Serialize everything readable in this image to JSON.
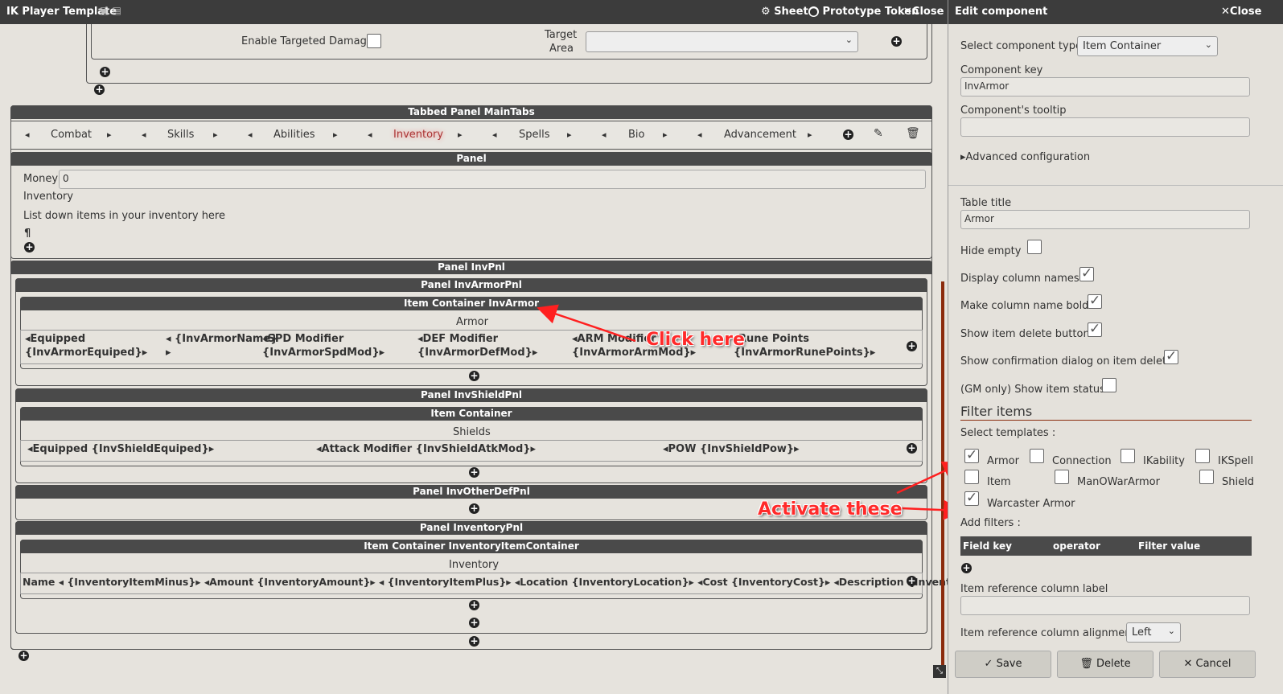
{
  "window": {
    "title": "IK Player Template",
    "sheet_label": "Sheet",
    "proto_label": "Prototype Token",
    "close_label": "Close"
  },
  "top_section": {
    "targeted_damage_label": "Enable Targeted Damage",
    "target_area_label_1": "Target",
    "target_area_label_2": "Area"
  },
  "tabbed_panel": {
    "header": "Tabbed Panel MainTabs",
    "tabs": [
      "Combat",
      "Skills",
      "Abilities",
      "Inventory",
      "Spells",
      "Bio",
      "Advancement"
    ],
    "active_tab": "Inventory"
  },
  "panel": {
    "header": "Panel",
    "money_label": "Money",
    "money_value": "0",
    "inventory_label": "Inventory",
    "description": "List down items in your inventory here",
    "pilcrow": "¶"
  },
  "panel_invpnl": {
    "header": "Panel InvPnl",
    "armor_panel_header": "Panel InvArmorPnl",
    "armor_container_header": "Item Container InvArmor",
    "armor_title": "Armor",
    "armor_cols": [
      {
        "line1": "◂Equipped",
        "line2": "{InvArmorEquiped}▸"
      },
      {
        "line1": "◂ {InvArmorName}",
        "line2": "▸"
      },
      {
        "line1": "◂SPD Modifier",
        "line2": "{InvArmorSpdMod}▸"
      },
      {
        "line1": "◂DEF Modifier",
        "line2": "{InvArmorDefMod}▸"
      },
      {
        "line1": "◂ARM Modifier",
        "line2": "{InvArmorArmMod}▸"
      },
      {
        "line1": "Rune Points",
        "line2": "{InvArmorRunePoints}▸"
      }
    ],
    "shield_panel_header": "Panel InvShieldPnl",
    "shield_container_header": "Item Container",
    "shield_title": "Shields",
    "shield_cols": [
      "◂Equipped {InvShieldEquiped}▸",
      "◂Attack Modifier {InvShieldAtkMod}▸",
      "◂POW {InvShieldPow}▸"
    ],
    "otherdef_header": "Panel InvOtherDefPnl",
    "inventory_panel_header": "Panel InventoryPnl",
    "inventory_container_header": "Item Container InventoryItemContainer",
    "inventory_title": "Inventory",
    "inventory_cols": "Name ◂ {InventoryItemMinus}▸ ◂Amount {InventoryAmount}▸ ◂ {InventoryItemPlus}▸ ◂Location {InventoryLocation}▸ ◂Cost {InventoryCost}▸ ◂Description {InventoryDescription}▸"
  },
  "annotations": {
    "click_here": "Click here",
    "activate_these": "Activate these"
  },
  "edit": {
    "header": "Edit component",
    "close_label": "Close",
    "type_label": "Select component type",
    "type_value": "Item Container",
    "key_label": "Component key",
    "key_value": "InvArmor",
    "tooltip_label": "Component's tooltip",
    "tooltip_value": "",
    "advanced": "▸Advanced configuration",
    "table_title_label": "Table title",
    "table_title_value": "Armor",
    "options": [
      {
        "label": "Hide empty",
        "checked": false
      },
      {
        "label": "Display column names",
        "checked": true
      },
      {
        "label": "Make column name bold",
        "checked": true
      },
      {
        "label": "Show item delete button",
        "checked": true
      },
      {
        "label": "Show confirmation dialog on item delete",
        "checked": true
      },
      {
        "label": "(GM only) Show item status",
        "checked": false
      }
    ],
    "filter_heading": "Filter items",
    "select_templates": "Select templates :",
    "templates": [
      {
        "label": "Armor",
        "checked": true
      },
      {
        "label": "Connection",
        "checked": false
      },
      {
        "label": "IKability",
        "checked": false
      },
      {
        "label": "IKSpell",
        "checked": false
      },
      {
        "label": "Item",
        "checked": false
      },
      {
        "label": "ManOWarArmor",
        "checked": false
      },
      {
        "label": "Shield",
        "checked": false
      },
      {
        "label": "Warcaster Armor",
        "checked": true
      }
    ],
    "add_filters": "Add filters :",
    "filter_cols": [
      "Field key",
      "operator",
      "Filter value"
    ],
    "ref_col_label": "Item reference column label",
    "ref_col_value": "",
    "ref_align_label": "Item reference column alignment",
    "ref_align_value": "Left",
    "save": "Save",
    "delete": "Delete",
    "cancel": "Cancel"
  }
}
